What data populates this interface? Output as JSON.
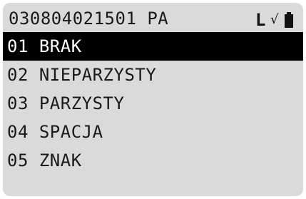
{
  "header": {
    "title": "030804021501 PA",
    "status_letter": "L",
    "check_symbol": "√",
    "battery_icon": "battery-full-icon"
  },
  "menu": {
    "items": [
      {
        "label": "01 BRAK",
        "selected": true
      },
      {
        "label": "02 NIEPARZYSTY",
        "selected": false
      },
      {
        "label": "03 PARZYSTY",
        "selected": false
      },
      {
        "label": "04 SPACJA",
        "selected": false
      },
      {
        "label": "05 ZNAK",
        "selected": false
      }
    ]
  },
  "colors": {
    "screen_background": "#dadada",
    "selection_background": "#000000",
    "selection_text": "#ffffff",
    "text": "#1a1a1a"
  }
}
